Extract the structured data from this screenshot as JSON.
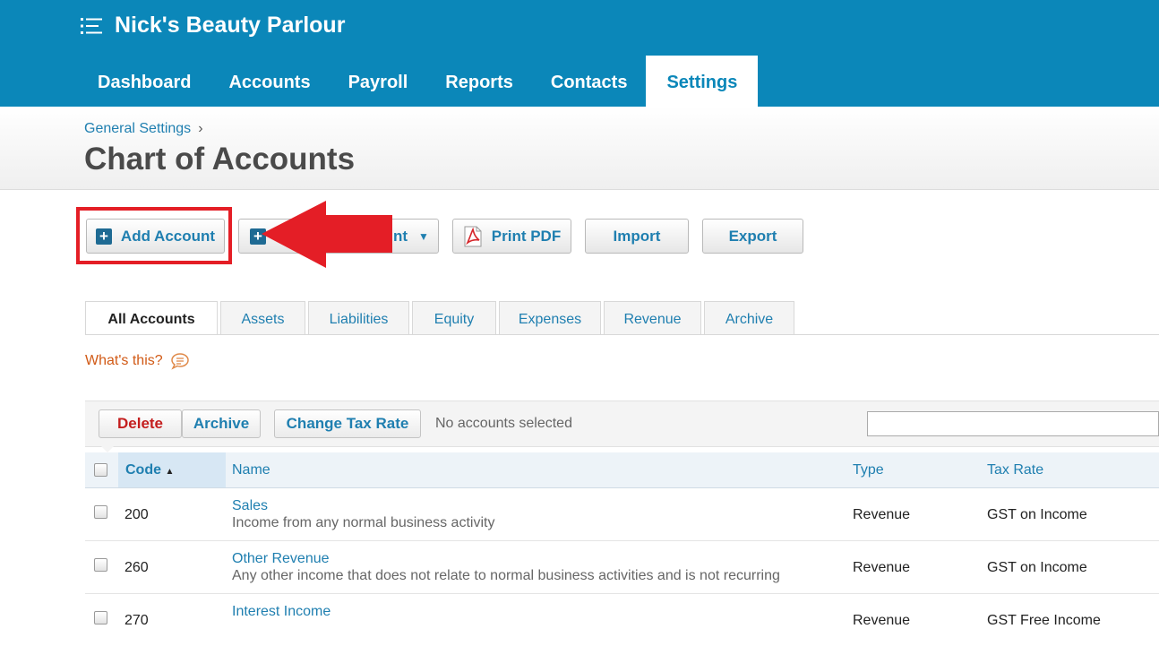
{
  "org_name": "Nick's Beauty Parlour",
  "nav": [
    "Dashboard",
    "Accounts",
    "Payroll",
    "Reports",
    "Contacts",
    "Settings"
  ],
  "breadcrumb": {
    "link": "General Settings",
    "separator": "›"
  },
  "page_title": "Chart of Accounts",
  "actions": {
    "add_account": "Add Account",
    "bank_account_partial": "nt",
    "print_pdf": "Print PDF",
    "import": "Import",
    "export": "Export"
  },
  "tabs": [
    "All Accounts",
    "Assets",
    "Liabilities",
    "Equity",
    "Expenses",
    "Revenue",
    "Archive"
  ],
  "whats_this": "What's this?",
  "toolbar": {
    "delete": "Delete",
    "archive": "Archive",
    "change_tax_rate": "Change Tax Rate",
    "status": "No accounts selected"
  },
  "columns": {
    "code": "Code",
    "name": "Name",
    "type": "Type",
    "tax_rate": "Tax Rate"
  },
  "rows": [
    {
      "code": "200",
      "name": "Sales",
      "description": "Income from any normal business activity",
      "type": "Revenue",
      "tax_rate": "GST on Income"
    },
    {
      "code": "260",
      "name": "Other Revenue",
      "description": "Any other income that does not relate to normal business activities and is not recurring",
      "type": "Revenue",
      "tax_rate": "GST on Income"
    },
    {
      "code": "270",
      "name": "Interest Income",
      "description": "",
      "type": "Revenue",
      "tax_rate": "GST Free Income"
    }
  ],
  "colors": {
    "brand": "#0b87b9",
    "link": "#1f7fb0",
    "highlight": "#e41e26",
    "delete": "#c41e1e"
  }
}
